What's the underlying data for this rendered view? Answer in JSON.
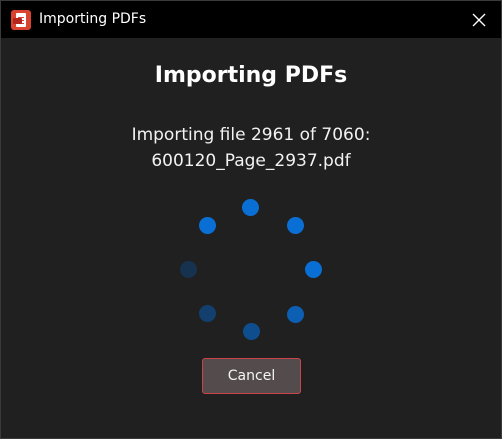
{
  "window": {
    "title": "Importing PDFs",
    "app_icon": "pdf-app-icon",
    "close_icon": "close-icon"
  },
  "dialog": {
    "heading": "Importing PDFs",
    "status_line1": "Importing file 2961 of 7060:",
    "status_line2": "600120_Page_2937.pdf",
    "cancel_label": "Cancel"
  },
  "spinner": {
    "icon": "loading-spinner-icon",
    "dot_colors": [
      "#0a6fd4",
      "#0a6fd4",
      "#0a6fd4",
      "#0c5fb3",
      "#0f4e8e",
      "#123f6e",
      "#16324f",
      "#0a6fd4"
    ]
  },
  "colors": {
    "accent": "#0a6fd4",
    "cancel_border": "#c8434a",
    "cancel_bg": "#544c4c"
  }
}
